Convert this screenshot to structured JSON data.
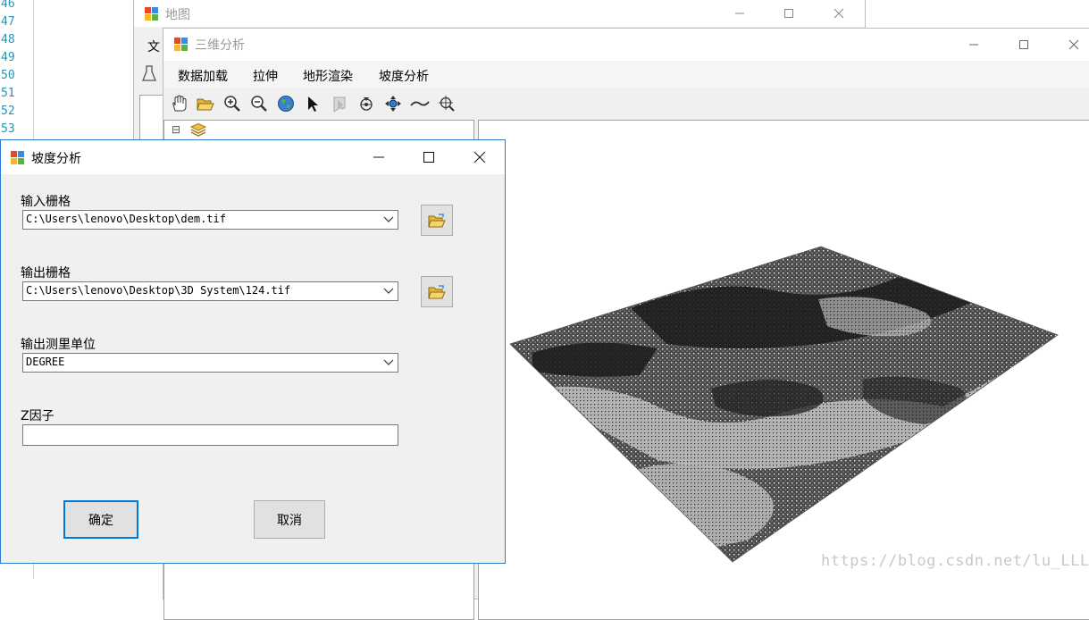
{
  "code_editor": {
    "line_numbers": [
      "46",
      "47",
      "48",
      "49",
      "50",
      "51",
      "52",
      "53"
    ]
  },
  "map_window": {
    "title": "地图",
    "menu_partial": "文"
  },
  "window_3d": {
    "title": "三维分析",
    "menu": [
      "数据加载",
      "拉伸",
      "地形渲染",
      "坡度分析"
    ],
    "toolbar_icons": [
      "pan-icon",
      "open-folder-icon",
      "zoom-in-icon",
      "zoom-out-icon",
      "globe-icon",
      "select-arrow-icon",
      "identify-icon",
      "navigate-icon",
      "fly-icon",
      "swipe-icon",
      "zoom-to-target-icon"
    ],
    "toc": {
      "expander": "⊟"
    },
    "watermark": "https://blog.csdn.net/lu_LLLR"
  },
  "slope_dialog": {
    "title": "坡度分析",
    "input_raster": {
      "label": "输入栅格",
      "value": "C:\\Users\\lenovo\\Desktop\\dem.tif"
    },
    "output_raster": {
      "label": "输出栅格",
      "value": "C:\\Users\\lenovo\\Desktop\\3D System\\124.tif"
    },
    "output_unit": {
      "label": "输出测里单位",
      "value": "DEGREE"
    },
    "z_factor": {
      "label": "Z因子",
      "value": ""
    },
    "ok_label": "确定",
    "cancel_label": "取消"
  },
  "colors": {
    "accent_blue": "#0078d7",
    "dialog_border": "#2c7bd6",
    "window_bg": "#f0f0f0",
    "line_number_color": "#2b91af"
  }
}
